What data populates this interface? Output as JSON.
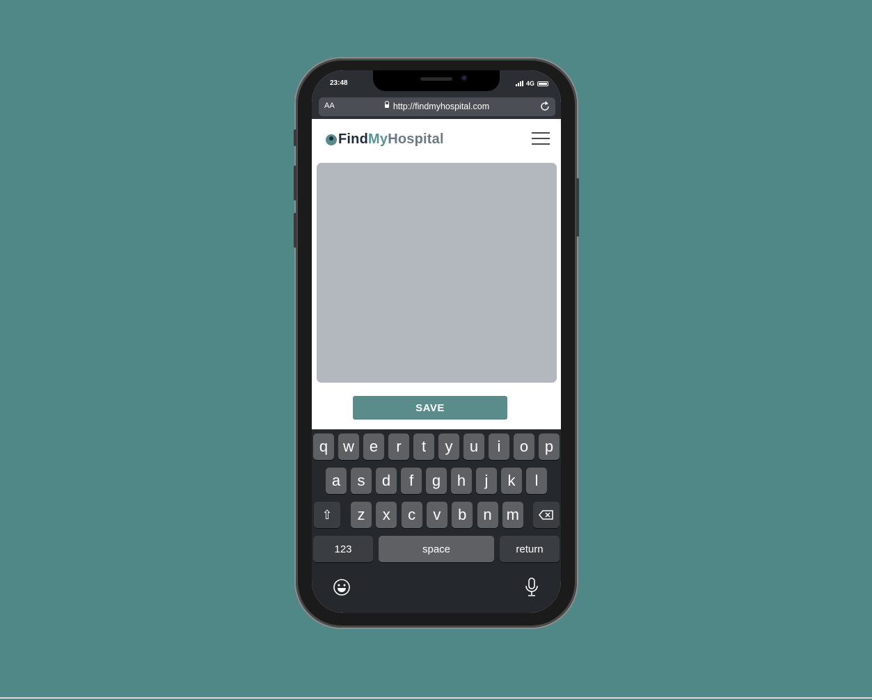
{
  "status": {
    "time": "23:48",
    "network": "4G"
  },
  "browser": {
    "text_size_label": "AA",
    "url": "http://findmyhospital.com"
  },
  "brand": {
    "find": "Find",
    "my": "My",
    "hospital": "Hospital"
  },
  "form": {
    "textarea_value": "",
    "save_label": "SAVE"
  },
  "keyboard": {
    "row1": [
      "q",
      "w",
      "e",
      "r",
      "t",
      "y",
      "u",
      "i",
      "o",
      "p"
    ],
    "row2": [
      "a",
      "s",
      "d",
      "f",
      "g",
      "h",
      "j",
      "k",
      "l"
    ],
    "row3": [
      "z",
      "x",
      "c",
      "v",
      "b",
      "n",
      "m"
    ],
    "shift": "⇧",
    "numbers": "123",
    "space": "space",
    "return": "return"
  },
  "colors": {
    "background": "#508888",
    "accent": "#5a8c8c",
    "textarea": "#b3b7be",
    "keyboard": "#25282c"
  }
}
